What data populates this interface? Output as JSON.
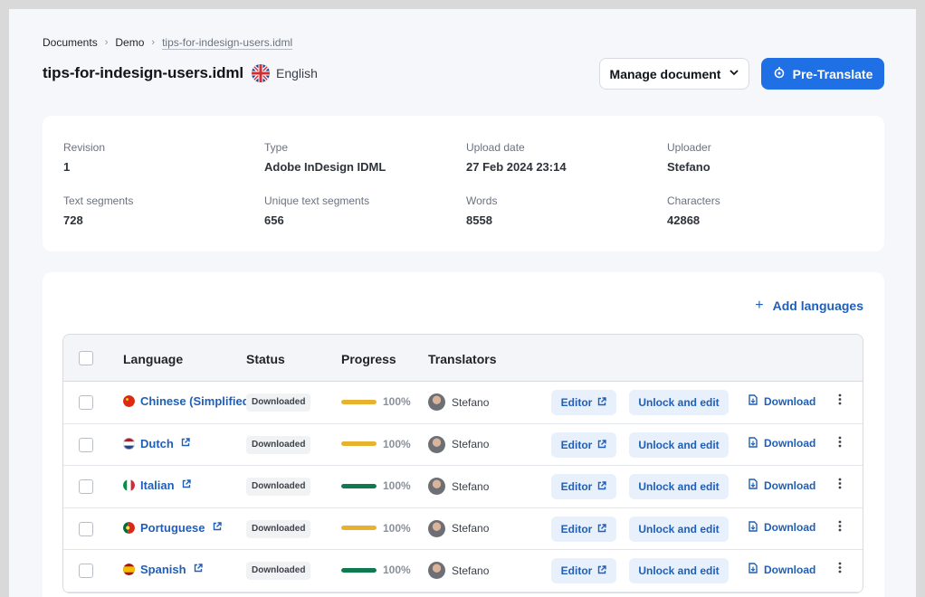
{
  "breadcrumb": {
    "items": [
      "Documents",
      "Demo"
    ],
    "current": "tips-for-indesign-users.idml",
    "separator": "›"
  },
  "document": {
    "title": "tips-for-indesign-users.idml",
    "language": "English",
    "language_flag_icon": "uk-flag-icon"
  },
  "actions": {
    "manage_label": "Manage document",
    "pretranslate_label": "Pre-Translate"
  },
  "info": {
    "revision_label": "Revision",
    "revision": "1",
    "type_label": "Type",
    "type": "Adobe InDesign IDML",
    "upload_label": "Upload date",
    "upload": "27 Feb 2024 23:14",
    "uploader_label": "Uploader",
    "uploader": "Stefano",
    "segments_label": "Text segments",
    "segments": "728",
    "unique_label": "Unique text segments",
    "unique": "656",
    "words_label": "Words",
    "words": "8558",
    "chars_label": "Characters",
    "chars": "42868"
  },
  "languages": {
    "add_label": "Add languages",
    "columns": [
      "Language",
      "Status",
      "Progress",
      "Translators"
    ],
    "editor_label": "Editor",
    "unlock_label": "Unlock and edit",
    "download_label": "Download",
    "rows": [
      {
        "name": "Chinese (Simplified)",
        "status": "Downloaded",
        "progress": 1.0,
        "pct": "100%",
        "bar_color": "#e8b12e",
        "translator": "Stefano",
        "flag": "china-flag-icon",
        "external": false
      },
      {
        "name": "Dutch",
        "status": "Downloaded",
        "progress": 1.0,
        "pct": "100%",
        "bar_color": "#e8b12e",
        "translator": "Stefano",
        "flag": "netherlands-flag-icon",
        "external": true
      },
      {
        "name": "Italian",
        "status": "Downloaded",
        "progress": 1.0,
        "pct": "100%",
        "bar_color": "#0f7a4f",
        "translator": "Stefano",
        "flag": "italy-flag-icon",
        "external": true
      },
      {
        "name": "Portuguese",
        "status": "Downloaded",
        "progress": 1.0,
        "pct": "100%",
        "bar_color": "#e8b12e",
        "translator": "Stefano",
        "flag": "portugal-flag-icon",
        "external": true
      },
      {
        "name": "Spanish",
        "status": "Downloaded",
        "progress": 1.0,
        "pct": "100%",
        "bar_color": "#0f7a4f",
        "translator": "Stefano",
        "flag": "spain-flag-icon",
        "external": true
      }
    ]
  },
  "colors": {
    "accent": "#1f6fe5",
    "link": "#1f5fb8"
  }
}
